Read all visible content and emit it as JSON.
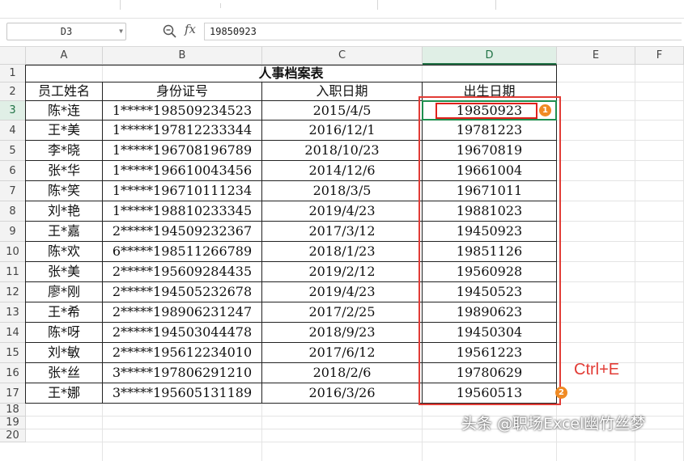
{
  "formula_bar": {
    "cell_ref": "D3",
    "zoom_icon": "zoom-icon",
    "fx_symbol": "fx",
    "value": "19850923"
  },
  "columns": [
    "A",
    "B",
    "C",
    "D",
    "E",
    "F"
  ],
  "rows": [
    "1",
    "2",
    "3",
    "4",
    "5",
    "6",
    "7",
    "8",
    "9",
    "10",
    "11",
    "12",
    "13",
    "14",
    "15",
    "16",
    "17",
    "18",
    "19",
    "20"
  ],
  "table": {
    "title": "人事档案表",
    "headers": [
      "员工姓名",
      "身份证号",
      "入职日期",
      "出生日期"
    ],
    "records": [
      [
        "陈*连",
        "1*****198509234523",
        "2015/4/5",
        "19850923"
      ],
      [
        "王*美",
        "1*****197812233344",
        "2016/12/1",
        "19781223"
      ],
      [
        "李*晓",
        "1*****196708196789",
        "2018/10/23",
        "19670819"
      ],
      [
        "张*华",
        "1*****196610043456",
        "2014/12/6",
        "19661004"
      ],
      [
        "陈*笑",
        "1*****196710111234",
        "2018/3/5",
        "19671011"
      ],
      [
        "刘*艳",
        "1*****198810233345",
        "2019/4/23",
        "19881023"
      ],
      [
        "王*嘉",
        "2*****194509232367",
        "2017/3/12",
        "19450923"
      ],
      [
        "陈*欢",
        "6*****198511266789",
        "2018/1/23",
        "19851126"
      ],
      [
        "张*美",
        "2*****195609284435",
        "2019/2/12",
        "19560928"
      ],
      [
        "廖*刚",
        "2*****194505232678",
        "2019/4/23",
        "19450523"
      ],
      [
        "王*希",
        "2*****198906231247",
        "2017/2/25",
        "19890623"
      ],
      [
        "陈*呀",
        "2*****194503044478",
        "2018/9/23",
        "19450304"
      ],
      [
        "刘*敏",
        "2*****195612234010",
        "2017/6/12",
        "19561223"
      ],
      [
        "张*丝",
        "3*****197806291210",
        "2018/2/6",
        "19780629"
      ],
      [
        "王*娜",
        "3*****195605131189",
        "2016/3/26",
        "19560513"
      ]
    ]
  },
  "selection": {
    "active_column": "D",
    "active_row": "3"
  },
  "annotations": {
    "badge1": "1",
    "badge2": "2",
    "shortcut": "Ctrl+E",
    "watermark": "头条 @职场Excel幽竹丝梦",
    "highlight_color": "#e23c36",
    "badge_color": "#f08a24",
    "selection_color": "#1e8e4e"
  }
}
